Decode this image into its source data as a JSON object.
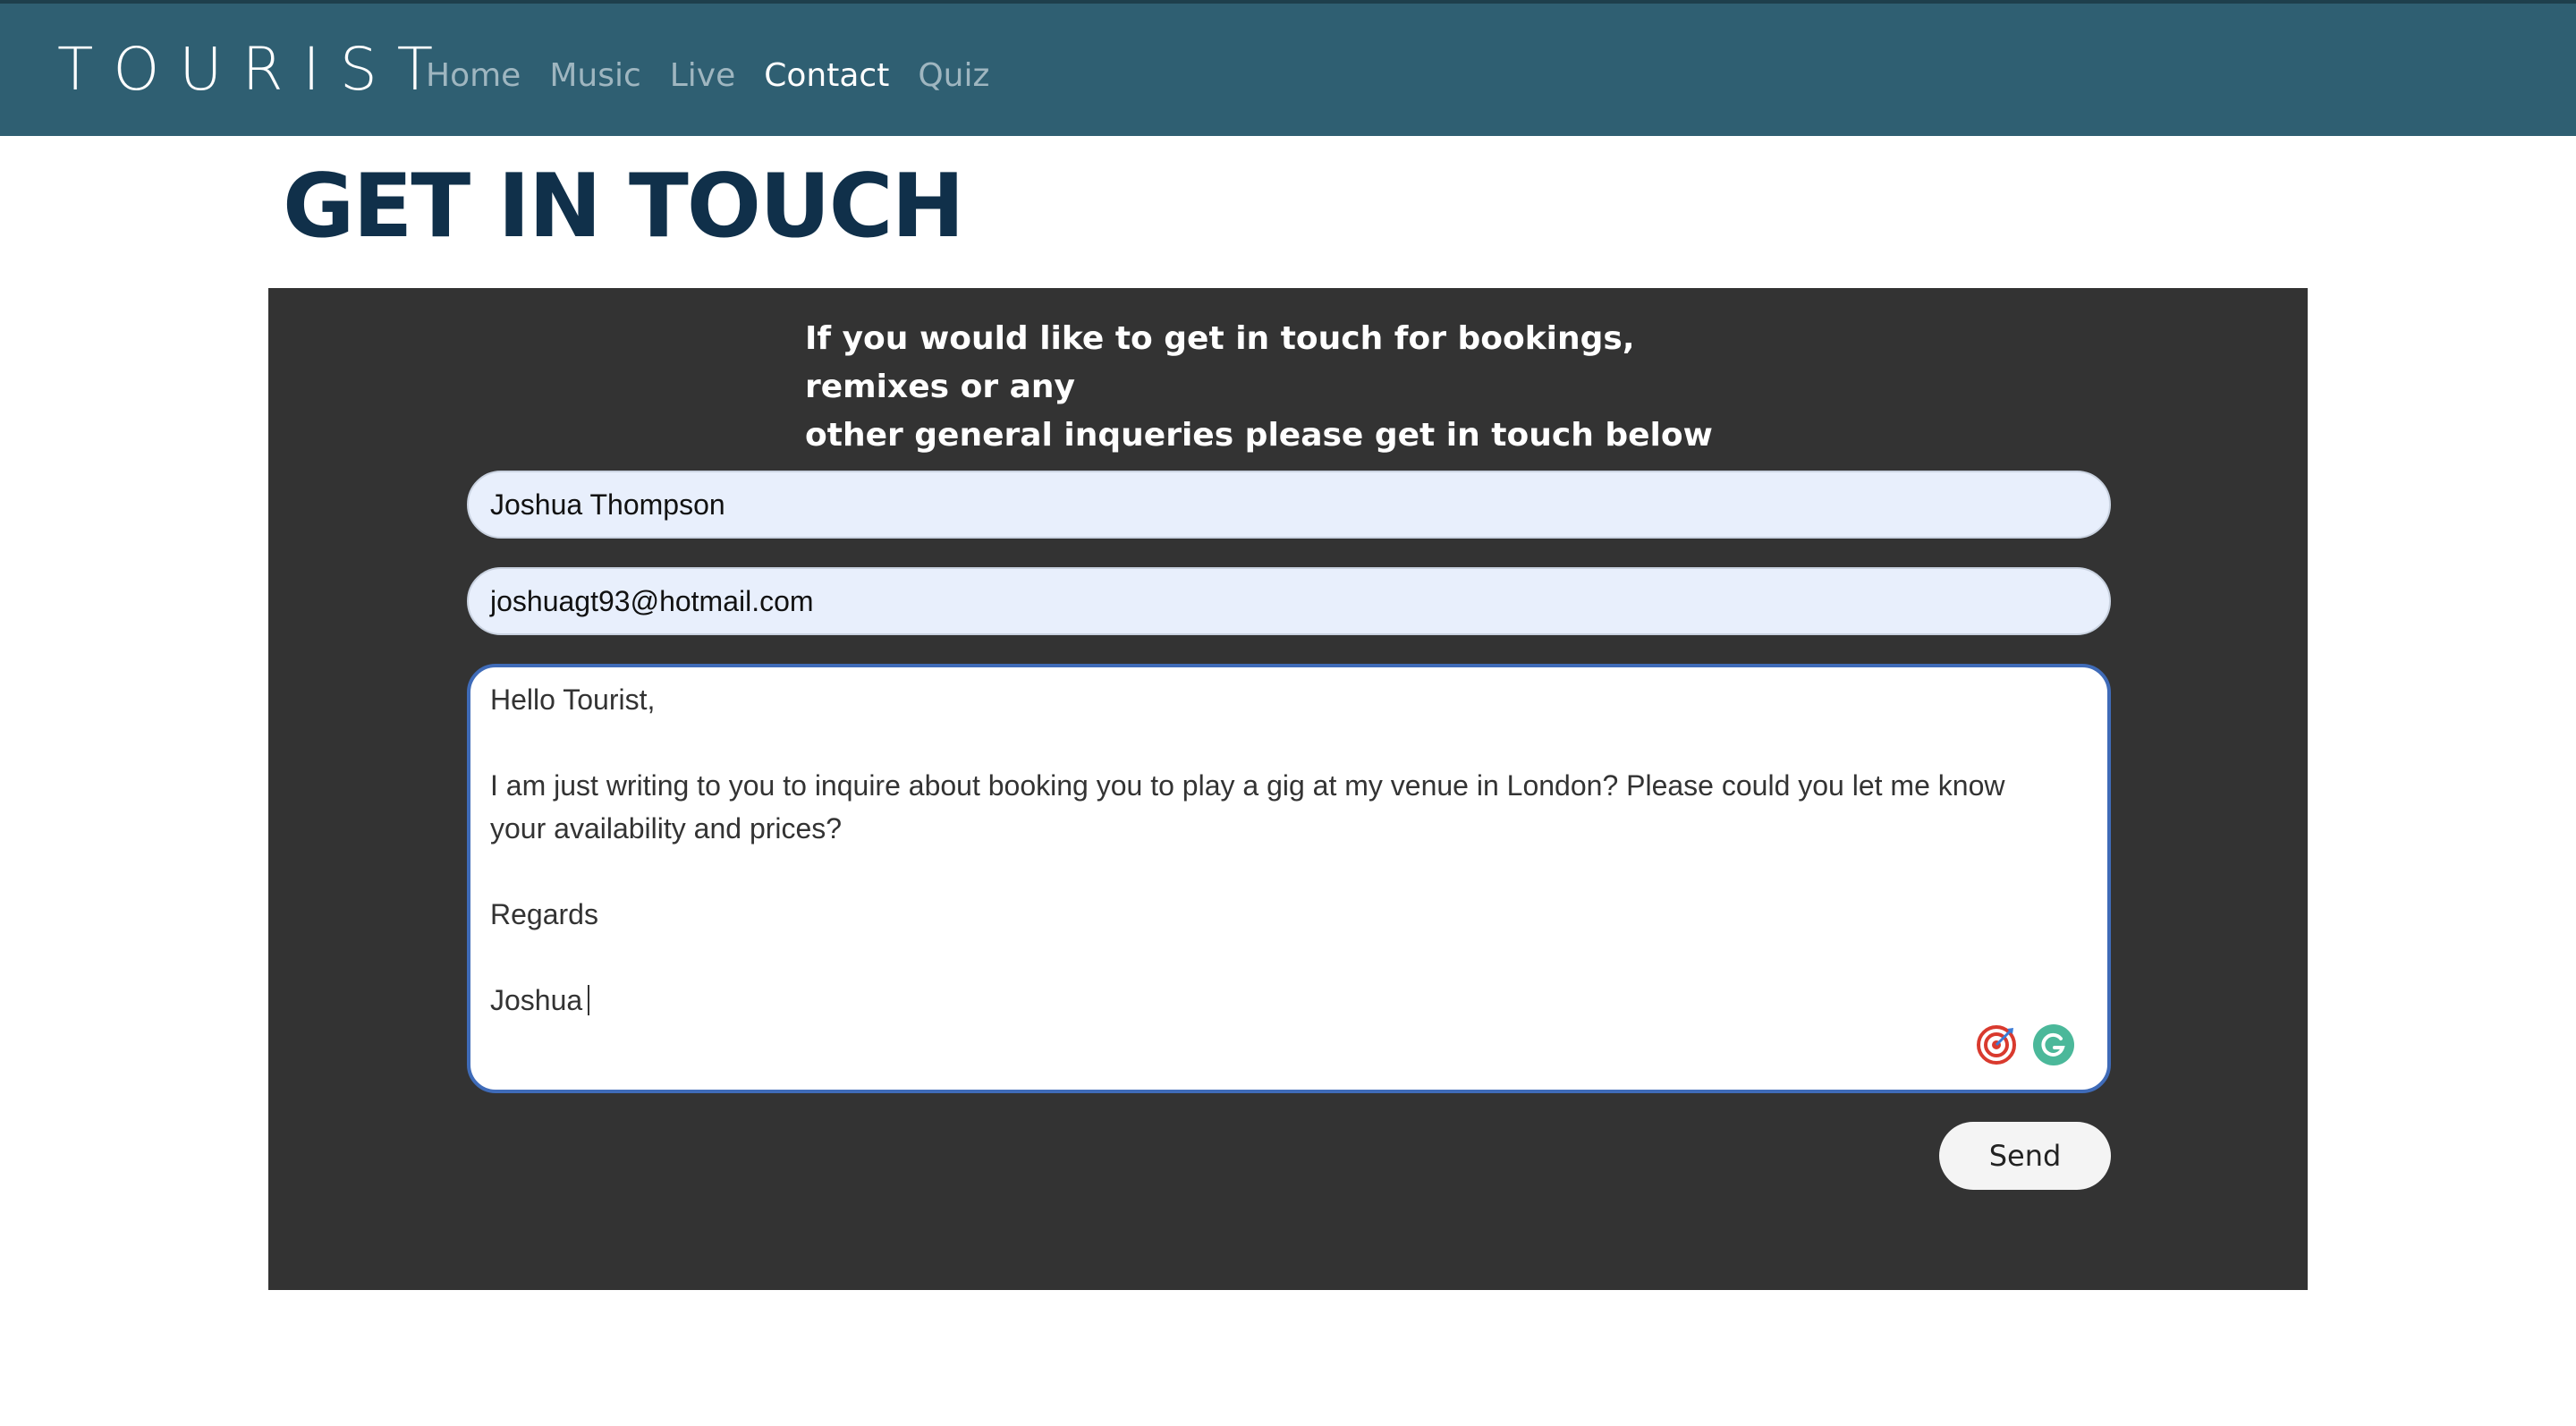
{
  "brand": {
    "name": "TOURIST"
  },
  "nav": {
    "items": [
      {
        "label": "Home"
      },
      {
        "label": "Music"
      },
      {
        "label": "Live"
      },
      {
        "label": "Contact"
      },
      {
        "label": "Quiz"
      }
    ],
    "active": "Contact"
  },
  "page": {
    "title": "GET IN TOUCH"
  },
  "contact": {
    "intro_line1": "If you would like to get in touch for bookings, remixes or any",
    "intro_line2": "other general inqueries please get in touch below",
    "name_value": "Joshua Thompson",
    "email_value": "joshuagt93@hotmail.com",
    "message_lines": [
      "Hello Tourist,",
      "",
      "I am just writing to you to inquire about booking you to play a gig at my venue in London? Please could you let me know",
      "your availability and prices?",
      "",
      "Regards",
      "",
      "Joshua"
    ],
    "send_label": "Send"
  },
  "colors": {
    "navbar_bg": "#2f5f72",
    "title": "#10304a",
    "panel_bg": "#333333",
    "input_bg": "#e8effc",
    "focus_border": "#3f6bb8"
  },
  "icons": {
    "extension_1": "target-icon",
    "extension_2": "grammarly-icon"
  }
}
